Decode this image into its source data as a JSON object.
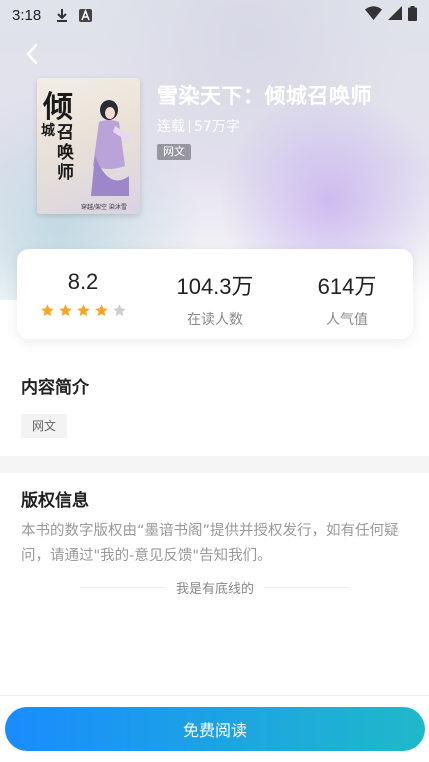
{
  "status_bar": {
    "time": "3:18"
  },
  "book": {
    "title": "雪染天下：倾城召唤师",
    "status": "连载",
    "word_count": "57万字",
    "category_tag": "网文",
    "cover": {
      "char1": "倾",
      "char2": "城",
      "char3": "召",
      "char4": "唤",
      "char5": "师",
      "footer": "穿越/架空  染沐雪"
    }
  },
  "stats": {
    "rating": "8.2",
    "stars": 4,
    "stars_total": 5,
    "reading": {
      "value": "104.3万",
      "label": "在读人数"
    },
    "popularity": {
      "value": "614万",
      "label": "人气值"
    }
  },
  "intro": {
    "title": "内容简介",
    "tag": "网文"
  },
  "copyright": {
    "title": "版权信息",
    "text": "本书的数字版权由“墨谙书阁”提供并授权发行，如有任何疑问，请通过\"我的-意见反馈\"告知我们。"
  },
  "bottom_line": "我是有底线的",
  "read_button": "免费阅读",
  "colors": {
    "accent_start": "#1a8cff",
    "accent_end": "#1fb9c9",
    "star": "#f5a623",
    "star_empty": "#cccccc"
  }
}
